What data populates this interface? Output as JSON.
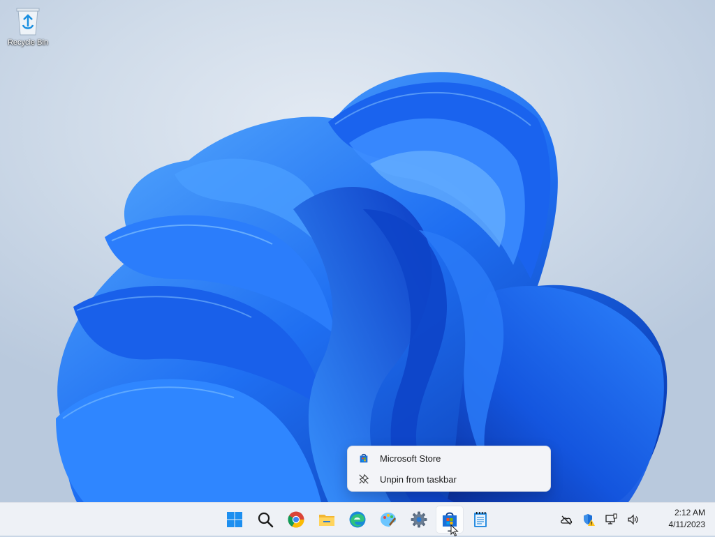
{
  "desktop": {
    "icons": [
      {
        "label": "Recycle Bin",
        "icon": "recycle-bin-icon"
      }
    ]
  },
  "context_menu": {
    "items": [
      {
        "label": "Microsoft Store",
        "icon": "microsoft-store-icon"
      },
      {
        "label": "Unpin from taskbar",
        "icon": "unpin-icon"
      }
    ]
  },
  "taskbar": {
    "apps": [
      {
        "name": "Start",
        "icon": "windows-start-icon"
      },
      {
        "name": "Search",
        "icon": "search-icon"
      },
      {
        "name": "Google Chrome",
        "icon": "chrome-icon"
      },
      {
        "name": "File Explorer",
        "icon": "file-explorer-icon"
      },
      {
        "name": "Microsoft Edge",
        "icon": "edge-icon"
      },
      {
        "name": "Paint",
        "icon": "paint-icon"
      },
      {
        "name": "Settings",
        "icon": "settings-gear-icon"
      },
      {
        "name": "Microsoft Store",
        "icon": "microsoft-store-icon",
        "active": true
      },
      {
        "name": "Notepad",
        "icon": "notepad-icon"
      }
    ],
    "tray": [
      {
        "icon": "onedrive-offline-icon"
      },
      {
        "icon": "windows-security-warning-icon"
      },
      {
        "icon": "network-icon"
      },
      {
        "icon": "volume-icon"
      }
    ],
    "clock": {
      "time": "2:12 AM",
      "date": "4/11/2023"
    }
  },
  "colors": {
    "bloom_dark": "#0a3fc2",
    "bloom_mid": "#1f6ff2",
    "bloom_light": "#4aa3ff",
    "taskbar_bg": "#eef1f6",
    "menu_bg": "#f3f4f8"
  }
}
